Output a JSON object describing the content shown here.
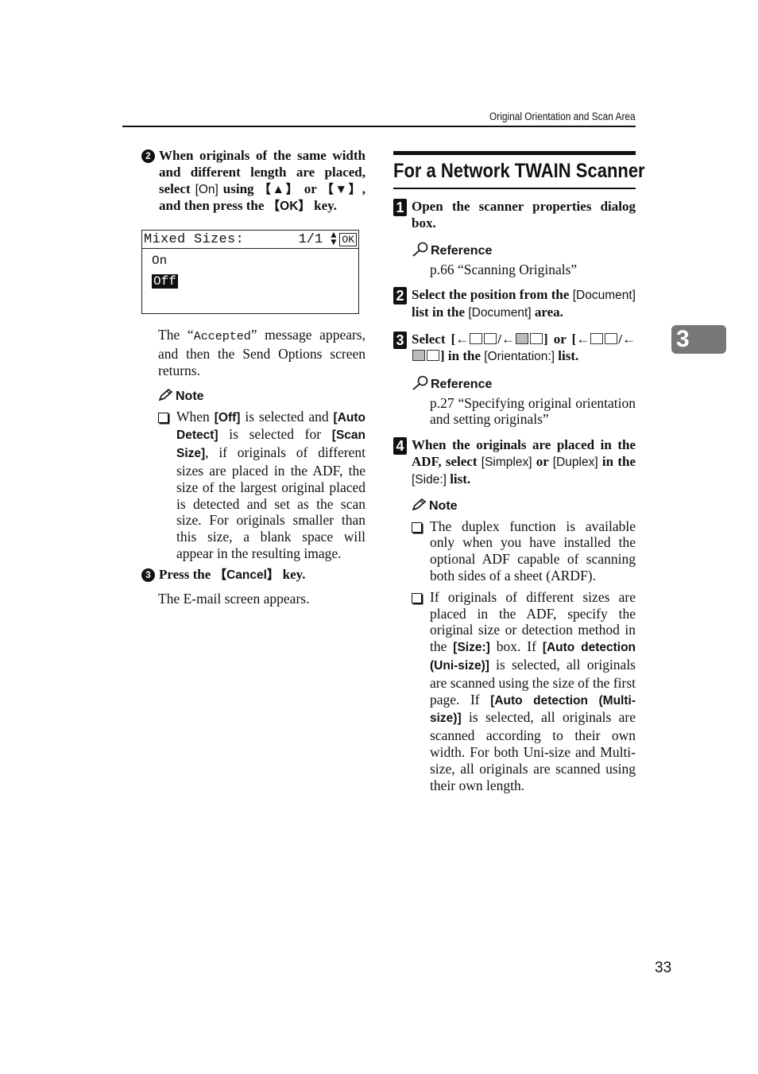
{
  "header": {
    "running_head": "Original Orientation and Scan Area"
  },
  "left_column": {
    "substep2": {
      "number": "2",
      "parts": {
        "a": "When originals of the same width and different length are placed, select ",
        "on_key": "[On]",
        "b": " using ",
        "up_key": "【▲】",
        "c": " or ",
        "down_key": "【▼】",
        "d": ", and then press the ",
        "ok_key": "【OK】",
        "e": " key."
      }
    },
    "lcd": {
      "title": "Mixed Sizes:",
      "page": "1/1",
      "arrows_icon": "up-down-arrows",
      "ok_label": "OK",
      "options": [
        {
          "label": "On",
          "selected": false
        },
        {
          "label": "Off",
          "selected": true
        }
      ]
    },
    "accepted_para": {
      "a": "The “",
      "code": "Accepted",
      "b": "” message appears, and then the Send Options screen returns."
    },
    "note": {
      "title": "Note",
      "items": [
        {
          "a": "When ",
          "k1": "[Off]",
          "b": " is selected and ",
          "k2": "[Auto Detect]",
          "c": " is selected for ",
          "k3": "[Scan Size]",
          "d": ", if originals of different sizes are placed in the ADF, the size of the largest original placed is detected and set as the scan size. For originals smaller than this size, a blank space will appear in the resulting image."
        }
      ]
    },
    "substep3": {
      "number": "3",
      "a": "Press the ",
      "key": "【Cancel】",
      "b": " key."
    },
    "email_para": "The E-mail screen appears."
  },
  "right_column": {
    "section_title": "For a Network TWAIN Scanner",
    "step1": {
      "number": "1",
      "text": "Open the scanner properties dialog box."
    },
    "ref1": {
      "title": "Reference",
      "body": "p.66 “Scanning Originals”"
    },
    "step2": {
      "number": "2",
      "a": "Select the position from the ",
      "k1": "[Document]",
      "b": " list in the ",
      "k2": "[Document]",
      "c": " area."
    },
    "step3": {
      "number": "3",
      "a": "Select ",
      "or": " or ",
      "b": " in the ",
      "k1": "[Orientation:]",
      "c": " list."
    },
    "ref2": {
      "title": "Reference",
      "body": "p.27 “Specifying original orientation and setting originals”"
    },
    "step4": {
      "number": "4",
      "a": "When the originals are placed in the ADF, select ",
      "k1": "[Simplex]",
      "b": " or ",
      "k2": "[Duplex]",
      "c": " in the ",
      "k3": "[Side:]",
      "d": " list."
    },
    "note": {
      "title": "Note",
      "items": [
        {
          "a": "The duplex function is available only when you have installed the optional ADF capable of scanning both sides of a sheet (ARDF)."
        },
        {
          "a": "If originals of different sizes are placed in the ADF, specify the original size or detection method in the ",
          "k1": "[Size:]",
          "b": " box. If ",
          "k2": "[Auto detection (Uni-size)]",
          "c": " is selected, all originals are scanned using the size of the first page. If ",
          "k3": "[Auto detection (Multi-size)]",
          "d": " is selected, all originals are scanned according to their own width. For both Uni-size and Multi-size, all originals are scanned using their own length."
        }
      ]
    }
  },
  "chapter_tab": "3",
  "page_number": "33"
}
